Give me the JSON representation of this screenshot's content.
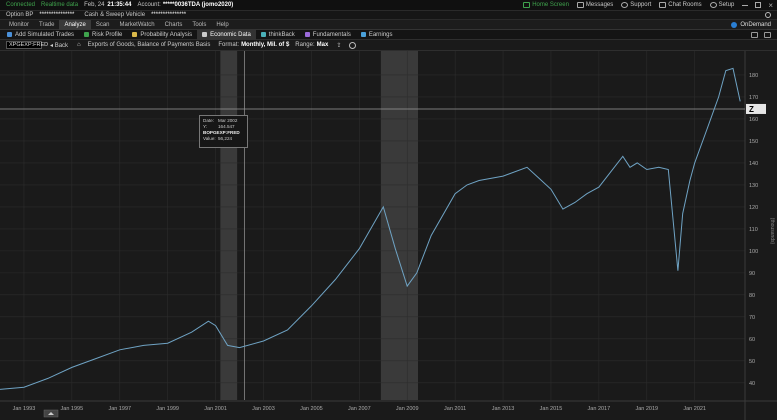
{
  "status_bar": {
    "connected": "Connected",
    "realtime": "Realtime data",
    "date": "Feb, 24",
    "time": "21:35:44",
    "account_label": "Account:",
    "account_value": "*****0036TDA (jomo2020)",
    "home_screen": "Home Screen",
    "messages": "Messages",
    "support": "Support",
    "chat_rooms": "Chat Rooms",
    "setup": "Setup"
  },
  "account_bar": {
    "option_bp": "Option BP",
    "masked_1": "***************",
    "cash_sweep": "Cash & Sweep Vehicle",
    "masked_2": "***************"
  },
  "nav": {
    "tabs": [
      "Monitor",
      "Trade",
      "Analyze",
      "Scan",
      "MarketWatch",
      "Charts",
      "Tools",
      "Help"
    ],
    "active": "Analyze",
    "on_demand": "OnDemand"
  },
  "tools": {
    "items": [
      {
        "label": "Add Simulated Trades",
        "color": "#4a90d9"
      },
      {
        "label": "Risk Profile",
        "color": "#3fa34d"
      },
      {
        "label": "Probability Analysis",
        "color": "#d9b84a"
      },
      {
        "label": "Economic Data",
        "color": "#cccccc"
      },
      {
        "label": "thinkBack",
        "color": "#4ab0b8"
      },
      {
        "label": "Fundamentals",
        "color": "#9b6ad9"
      },
      {
        "label": "Earnings",
        "color": "#4aa0d9"
      }
    ],
    "active": "Economic Data"
  },
  "chart_bar": {
    "symbol": "XPGEXP:FRED",
    "back": "Back",
    "description": "Exports of Goods, Balance of Payments Basis",
    "format_label": "Format:",
    "format_value": "Monthly, Mil. of $",
    "range_label": "Range:",
    "range_value": "Max"
  },
  "tooltip": {
    "date_label": "Date:",
    "date_value": "Mar 2002",
    "y_label": "Y:",
    "y_value": "164.547",
    "series": "BOPGEXP:FRED",
    "value_label": "Value:",
    "value_value": "56,224"
  },
  "chart_data": {
    "type": "line",
    "series": [
      {
        "name": "BOPGEXP:FRED",
        "x": [
          1992.0,
          1993.0,
          1994.0,
          1995.0,
          1996.0,
          1997.0,
          1998.0,
          1999.0,
          2000.0,
          2000.7,
          2001.0,
          2001.5,
          2002.0,
          2003.0,
          2004.0,
          2005.0,
          2006.0,
          2007.0,
          2008.0,
          2008.5,
          2009.0,
          2009.4,
          2010.0,
          2011.0,
          2011.5,
          2012.0,
          2013.0,
          2014.0,
          2014.5,
          2015.0,
          2015.5,
          2016.0,
          2016.5,
          2017.0,
          2018.0,
          2018.3,
          2018.6,
          2019.0,
          2019.5,
          2019.9,
          2020.3,
          2020.5,
          2020.8,
          2021.0,
          2021.5,
          2022.0,
          2022.3,
          2022.6,
          2022.9
        ],
        "y": [
          37,
          38,
          42,
          47,
          51,
          55,
          57,
          58,
          63,
          68,
          66,
          57,
          56,
          59,
          64,
          75,
          87,
          101,
          120,
          101,
          84,
          90,
          107,
          126,
          130,
          132,
          134,
          138,
          133,
          128,
          119,
          122,
          126,
          129,
          143,
          138,
          140,
          137,
          138,
          137,
          91,
          117,
          132,
          140,
          155,
          170,
          182,
          183,
          168
        ]
      }
    ],
    "x_ticks": [
      "Jan 1993",
      "Jan 1995",
      "Jan 1997",
      "Jan 1999",
      "Jan 2001",
      "Jan 2003",
      "Jan 2005",
      "Jan 2007",
      "Jan 2009",
      "Jan 2011",
      "Jan 2013",
      "Jan 2015",
      "Jan 2017",
      "Jan 2019",
      "Jan 2021"
    ],
    "y_ticks": [
      40,
      50,
      60,
      70,
      80,
      90,
      100,
      110,
      120,
      130,
      140,
      150,
      160,
      170,
      180
    ],
    "y_label": "(thousands)",
    "ylim": [
      34,
      190
    ],
    "xlim": [
      1992.0,
      2023.1
    ],
    "recessions": [
      [
        2001.2,
        2001.9
      ],
      [
        2007.9,
        2009.45
      ]
    ],
    "crosshair": {
      "x": 2002.2,
      "y": 164.547
    },
    "grid": true,
    "colors": {
      "line": "#6fa3c4",
      "grid": "#2c2c2c",
      "recession": "#3a3a3a",
      "crosshair": "#9a9a9a"
    }
  }
}
